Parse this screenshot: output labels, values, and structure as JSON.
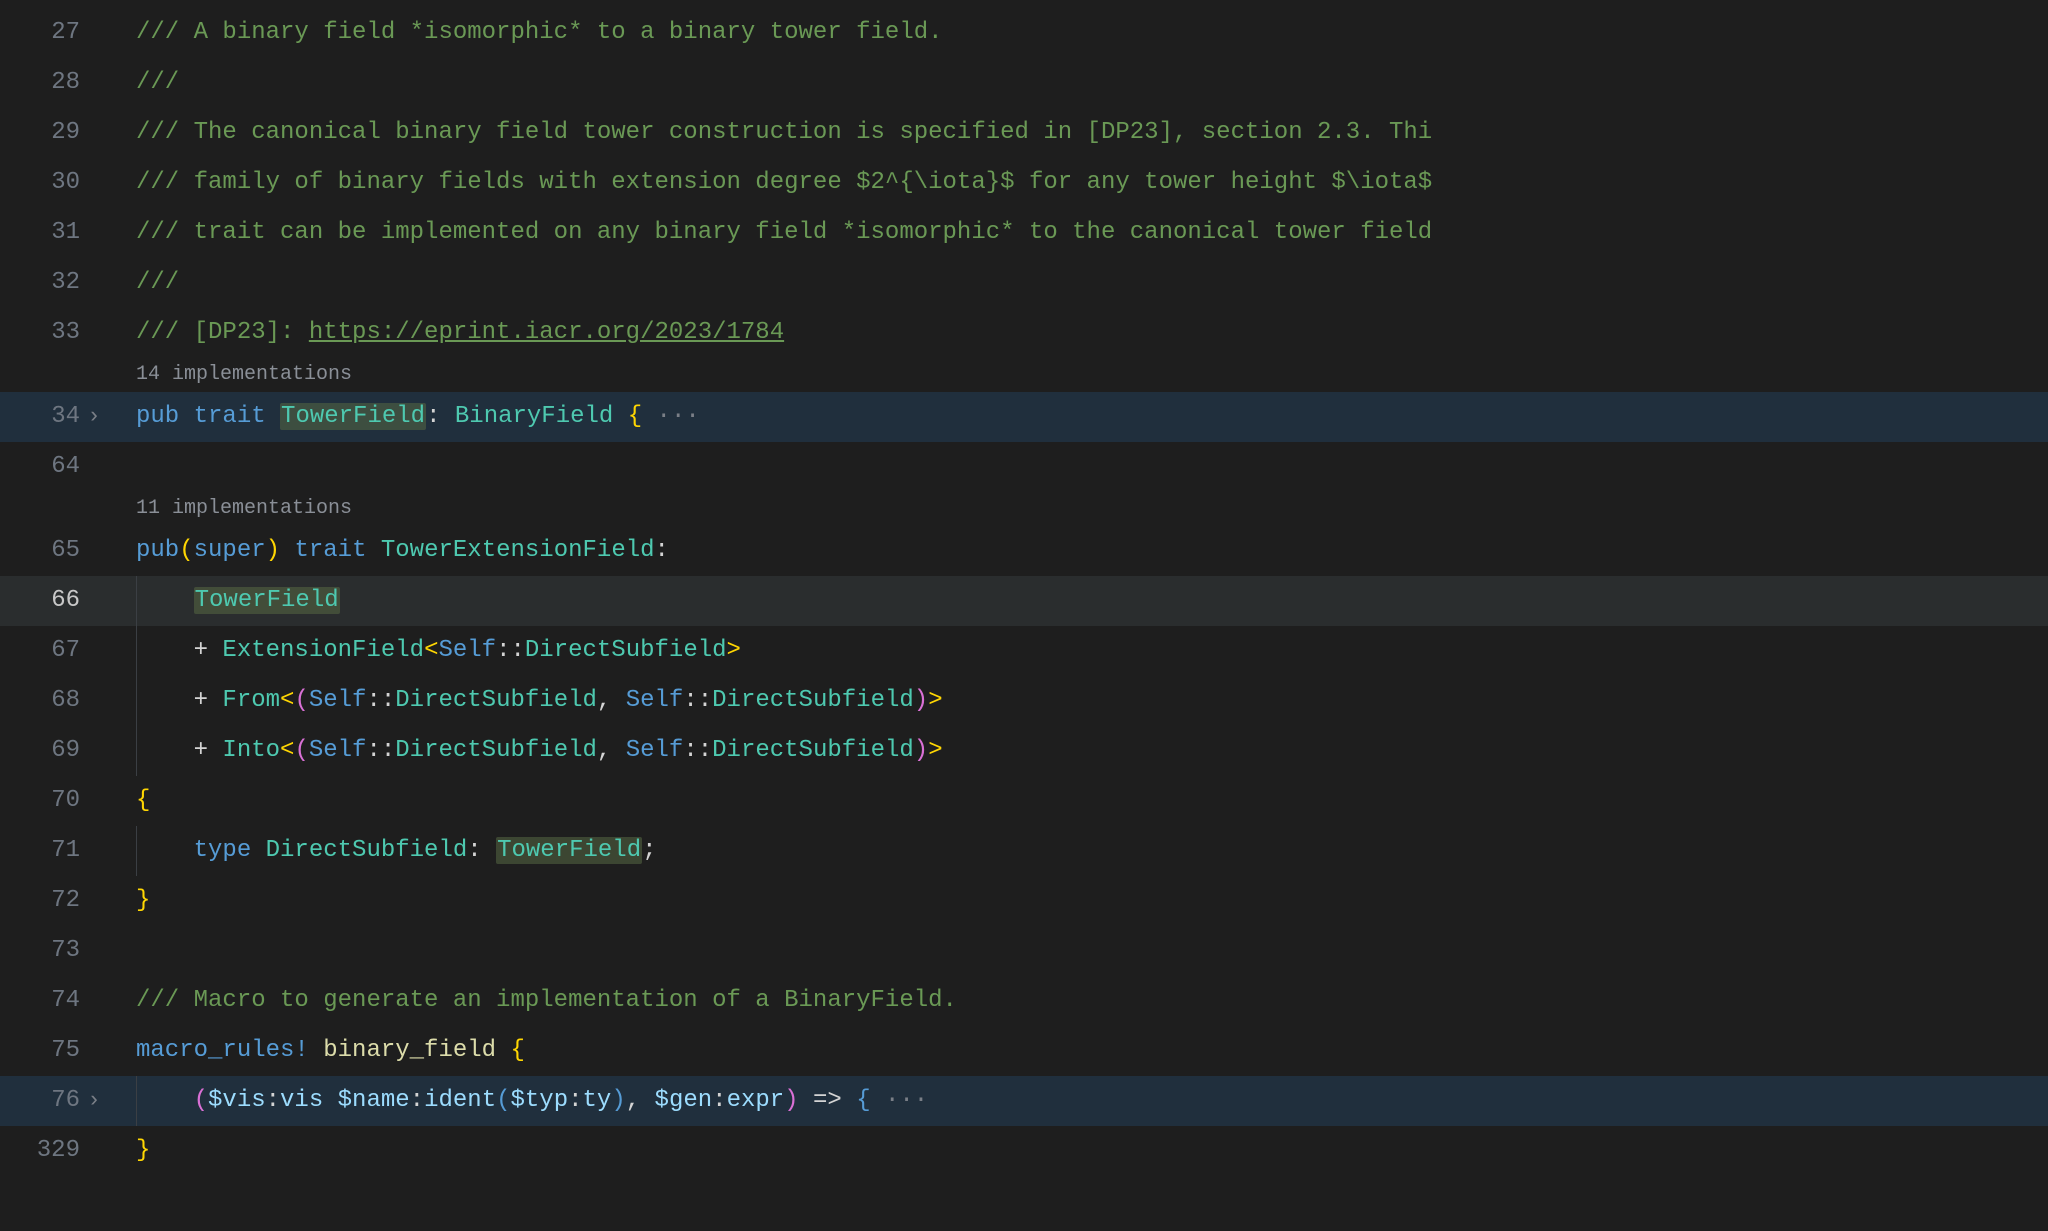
{
  "gutter": {
    "l27": "27",
    "l28": "28",
    "l29": "29",
    "l30": "30",
    "l31": "31",
    "l32": "32",
    "l33": "33",
    "l34": "34",
    "l64": "64",
    "l65": "65",
    "l66": "66",
    "l67": "67",
    "l68": "68",
    "l69": "69",
    "l70": "70",
    "l71": "71",
    "l72": "72",
    "l73": "73",
    "l74": "74",
    "l75": "75",
    "l76": "76",
    "l329": "329"
  },
  "codelens": {
    "impl14": "14 implementations",
    "impl11": "11 implementations"
  },
  "tokens": {
    "l27_c": "/// A binary field *isomorphic* to a binary tower field.",
    "l28_c": "///",
    "l29_c": "/// The canonical binary field tower construction is specified in [DP23], section 2.3. Thi",
    "l30_c": "/// family of binary fields with extension degree $2^{\\iota}$ for any tower height $\\iota$",
    "l31_c": "/// trait can be implemented on any binary field *isomorphic* to the canonical tower field",
    "l32_c": "///",
    "l33_pre": "/// [DP23]: ",
    "l33_url": "https://eprint.iacr.org/2023/1784",
    "l34_pub": "pub",
    "l34_trait": "trait",
    "l34_name": "TowerField",
    "l34_colon": ": ",
    "l34_super": "BinaryField",
    "l34_lb": " {",
    "l34_dots": " ···",
    "l65_pub": "pub",
    "l65_lp": "(",
    "l65_super": "super",
    "l65_rp": ") ",
    "l65_trait": "trait",
    "l65_name": "TowerExtensionField",
    "l65_colon": ":",
    "l66_tf": "TowerField",
    "l67_plus": "+ ",
    "l67_ext": "ExtensionField",
    "l67_lt": "<",
    "l67_self": "Self",
    "l67_cc": "::",
    "l67_ds": "DirectSubfield",
    "l67_gt": ">",
    "l68_plus": "+ ",
    "l68_from": "From",
    "l68_lt": "<",
    "l68_lp": "(",
    "l68_self1": "Self",
    "l68_cc1": "::",
    "l68_ds1": "DirectSubfield",
    "l68_comma": ", ",
    "l68_self2": "Self",
    "l68_cc2": "::",
    "l68_ds2": "DirectSubfield",
    "l68_rp": ")",
    "l68_gt": ">",
    "l69_plus": "+ ",
    "l69_into": "Into",
    "l69_lt": "<",
    "l69_lp": "(",
    "l69_self1": "Self",
    "l69_cc1": "::",
    "l69_ds1": "DirectSubfield",
    "l69_comma": ", ",
    "l69_self2": "Self",
    "l69_cc2": "::",
    "l69_ds2": "DirectSubfield",
    "l69_rp": ")",
    "l69_gt": ">",
    "l70_lb": "{",
    "l71_type": "type",
    "l71_name": "DirectSubfield",
    "l71_colon": ": ",
    "l71_tf": "TowerField",
    "l71_semi": ";",
    "l72_rb": "}",
    "l74_c": "/// Macro to generate an implementation of a BinaryField.",
    "l75_macro": "macro_rules!",
    "l75_name": "binary_field",
    "l75_lb": " {",
    "l76_lp": "(",
    "l76_vis_d": "$vis",
    "l76_vis_c": ":",
    "l76_vis_k": "vis",
    "l76_sp1": " ",
    "l76_name_d": "$name",
    "l76_name_c": ":",
    "l76_name_k": "ident",
    "l76_ilp": "(",
    "l76_typ_d": "$typ",
    "l76_typ_c": ":",
    "l76_typ_k": "ty",
    "l76_irp": ")",
    "l76_comma": ", ",
    "l76_gen_d": "$gen",
    "l76_gen_c": ":",
    "l76_gen_k": "expr",
    "l76_rp": ")",
    "l76_arrow": " => ",
    "l76_lb": "{",
    "l76_dots": " ···",
    "l329_rb": "}"
  }
}
